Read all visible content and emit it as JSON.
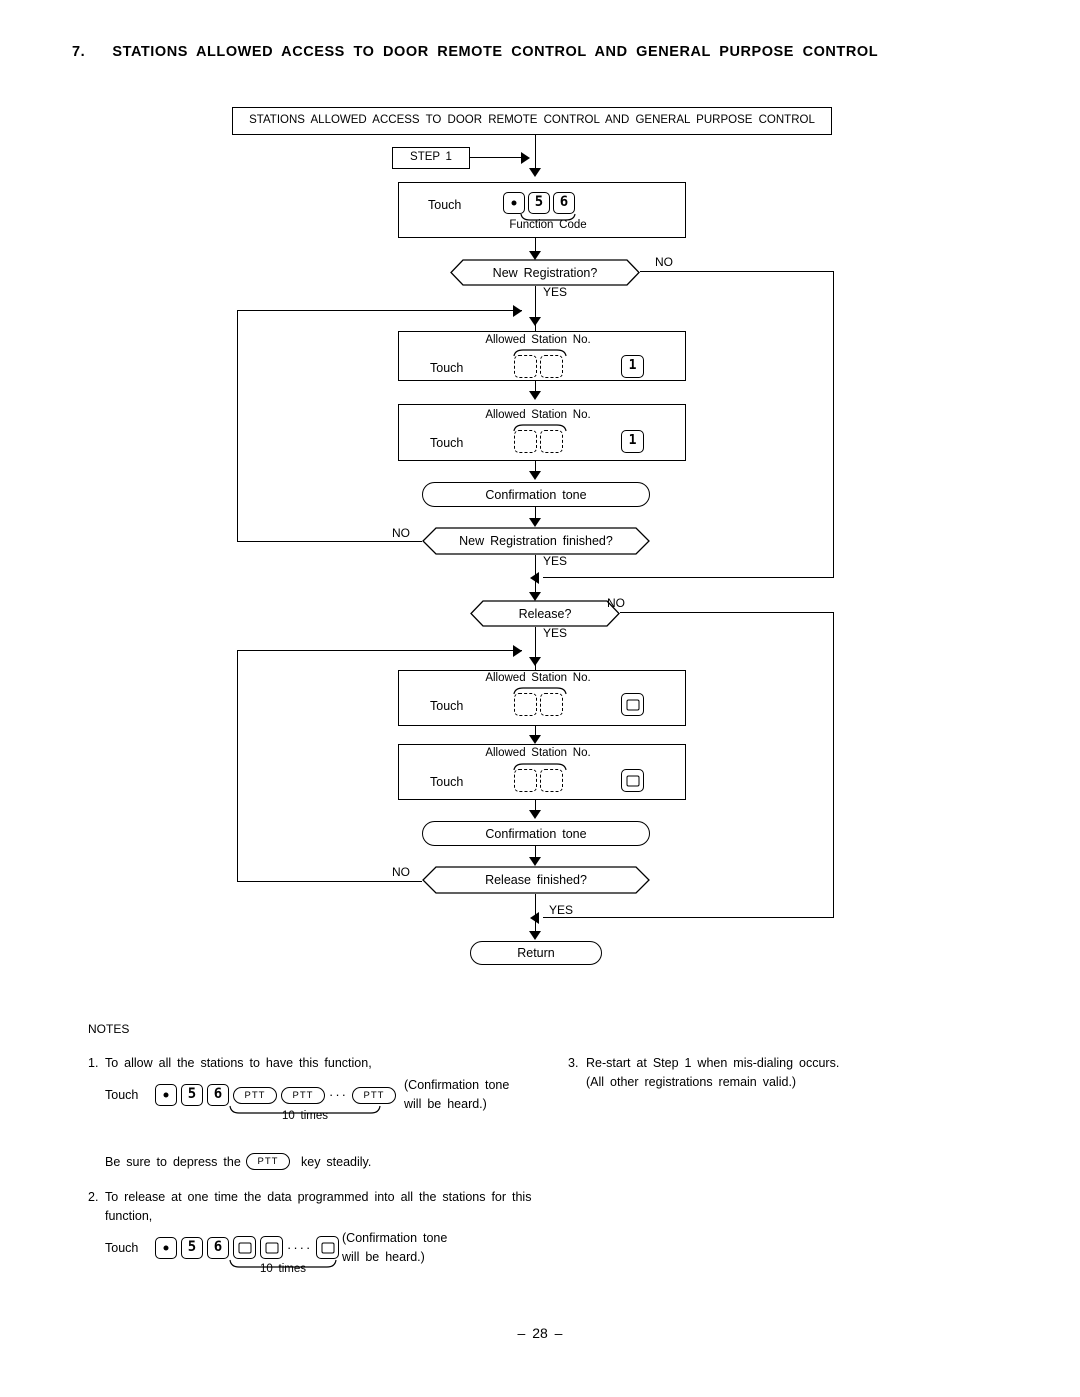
{
  "section": {
    "number": "7.",
    "title": "STATIONS ALLOWED ACCESS TO DOOR REMOTE CONTROL AND GENERAL PURPOSE CONTROL"
  },
  "flowchart": {
    "header": "STATIONS ALLOWED ACCESS TO DOOR REMOTE CONTROL AND GENERAL PURPOSE CONTROL",
    "step_label": "STEP 1",
    "touch_label": "Touch",
    "function_code_caption": "Function Code",
    "function_code_keys": [
      "dot-key",
      "5-key",
      "6-key"
    ],
    "decisions": [
      {
        "text": "New Registration?",
        "yes": "YES",
        "no": "NO"
      },
      {
        "text": "New Registration finished?",
        "yes": "YES",
        "no": "NO"
      },
      {
        "text": "Release?",
        "yes": "YES",
        "no": "NO"
      },
      {
        "text": "Release finished?",
        "yes": "YES",
        "no": "NO"
      }
    ],
    "station_boxes": [
      {
        "caption": "Allowed Station No.",
        "touch": "Touch",
        "trailing_key": "1"
      },
      {
        "caption": "Allowed Station No.",
        "touch": "Touch",
        "trailing_key": "1"
      },
      {
        "caption": "Allowed Station No.",
        "touch": "Touch",
        "trailing_key": "0"
      },
      {
        "caption": "Allowed Station No.",
        "touch": "Touch",
        "trailing_key": "0"
      }
    ],
    "confirmation_tone": "Confirmation tone",
    "return": "Return"
  },
  "notes": {
    "heading": "NOTES",
    "items": [
      {
        "num": "1.",
        "text": "To allow all the stations to have this function,",
        "touch": "Touch",
        "keys": [
          "dot-key",
          "5-key",
          "6-key",
          "PTT",
          "PTT",
          "dots",
          "PTT"
        ],
        "brace_caption": "10 times",
        "result_line1": "(Confirmation tone",
        "result_line2": "will be heard.)",
        "extra_prefix": "Be sure to depress the",
        "extra_key": "PTT",
        "extra_suffix": "key steadily."
      },
      {
        "num": "2.",
        "text_line1": "To release at one time the data programmed into all the stations for this",
        "text_line2": "function,",
        "touch": "Touch",
        "keys": [
          "dot-key",
          "5-key",
          "6-key",
          "0-key",
          "0-key",
          "dots",
          "0-key"
        ],
        "brace_caption": "10 times",
        "result_line1": "(Confirmation tone",
        "result_line2": "will be heard.)"
      },
      {
        "num": "3.",
        "text_line1": "Re-start at Step 1 when mis-dialing occurs.",
        "text_line2": "(All other registrations remain valid.)"
      }
    ],
    "ptt_label": "PTT",
    "dots_glyph": "···",
    "dots_glyph4": "····"
  },
  "page_number": "– 28 –"
}
